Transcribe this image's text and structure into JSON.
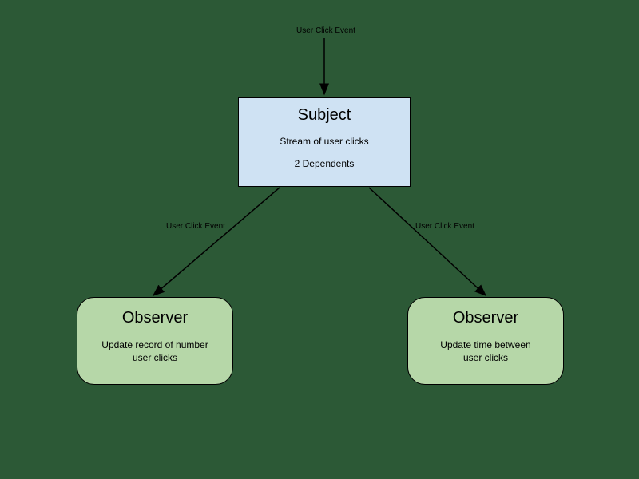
{
  "diagram": {
    "top_event_label": "User Click Event",
    "subject": {
      "title": "Subject",
      "line1": "Stream of user clicks",
      "line2": "2 Dependents"
    },
    "edge_left_label": "User Click Event",
    "edge_right_label": "User Click Event",
    "observer_left": {
      "title": "Observer",
      "desc_line1": "Update record of number",
      "desc_line2": "user clicks"
    },
    "observer_right": {
      "title": "Observer",
      "desc_line1": "Update time between",
      "desc_line2": "user clicks"
    }
  }
}
